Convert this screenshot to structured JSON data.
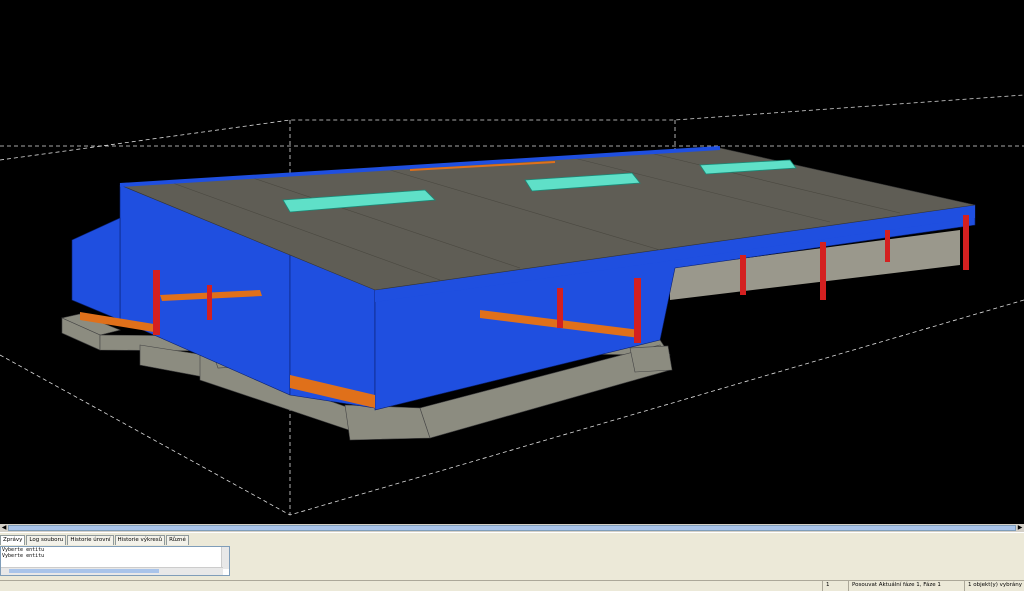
{
  "tabs": [
    {
      "label": "Zprávy"
    },
    {
      "label": "Log souboru"
    },
    {
      "label": "Historie úrovní"
    },
    {
      "label": "Historie výkresů"
    },
    {
      "label": "Různé"
    }
  ],
  "log": {
    "lines": [
      "Vyberte entitu",
      "Vyberte entitu"
    ]
  },
  "status": {
    "count": "1",
    "mode_text": "Posouvat  Aktuální fáze 1, Fáze 1",
    "selection_text": "1 objekt(y) vybrány"
  },
  "colors": {
    "wall": "#1f4fe0",
    "roof": "#5f5d55",
    "skylight": "#5fe0c8",
    "column": "#d42020",
    "footing": "#8c8c80",
    "beam": "#e0701a"
  }
}
